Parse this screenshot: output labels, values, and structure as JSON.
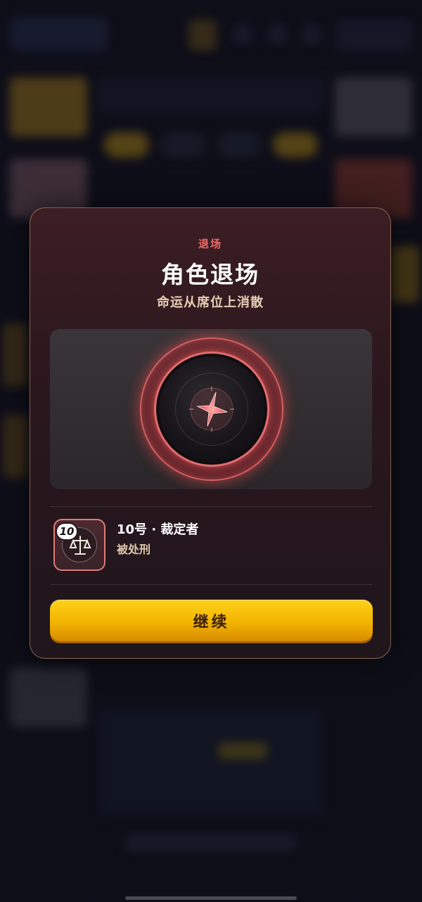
{
  "modal": {
    "eyebrow": "退场",
    "title": "角色退场",
    "subtitle": "命运从席位上消散"
  },
  "seat": {
    "number": "10",
    "name": "10号 · 裁定者",
    "status": "被处刑"
  },
  "actions": {
    "continue_label": "继续"
  },
  "icons": {
    "emblem": "star-shard-icon",
    "role": "scales-icon"
  },
  "colors": {
    "accent_red": "#f06a6a",
    "button_yellow": "#f2b300",
    "modal_border": "#cea078"
  }
}
